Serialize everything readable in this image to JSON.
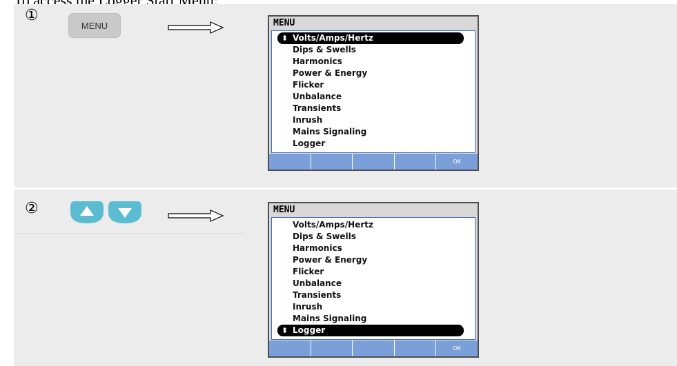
{
  "heading": "To access the Logger Start Menu:",
  "steps": [
    {
      "number": "①",
      "key_label": "MENU"
    },
    {
      "number": "②",
      "keys": [
        "up-arrow-key",
        "down-arrow-key"
      ]
    }
  ],
  "screen": {
    "title": "MENU",
    "items": [
      "Volts/Amps/Hertz",
      "Dips & Swells",
      "Harmonics",
      "Power & Energy",
      "Flicker",
      "Unbalance",
      "Transients",
      "Inrush",
      "Mains Signaling",
      "Logger"
    ],
    "selector_glyph": "⬍",
    "softkeys": [
      "",
      "",
      "",
      "",
      "OK"
    ]
  },
  "screen1_selected": "Volts/Amps/Hertz",
  "screen2_selected": "Logger",
  "colors": {
    "panel": "#ececec",
    "softkey_bar": "#7b9fd9",
    "arrow_key": "#5bbcd1",
    "list_border": "#3f6fb8"
  }
}
